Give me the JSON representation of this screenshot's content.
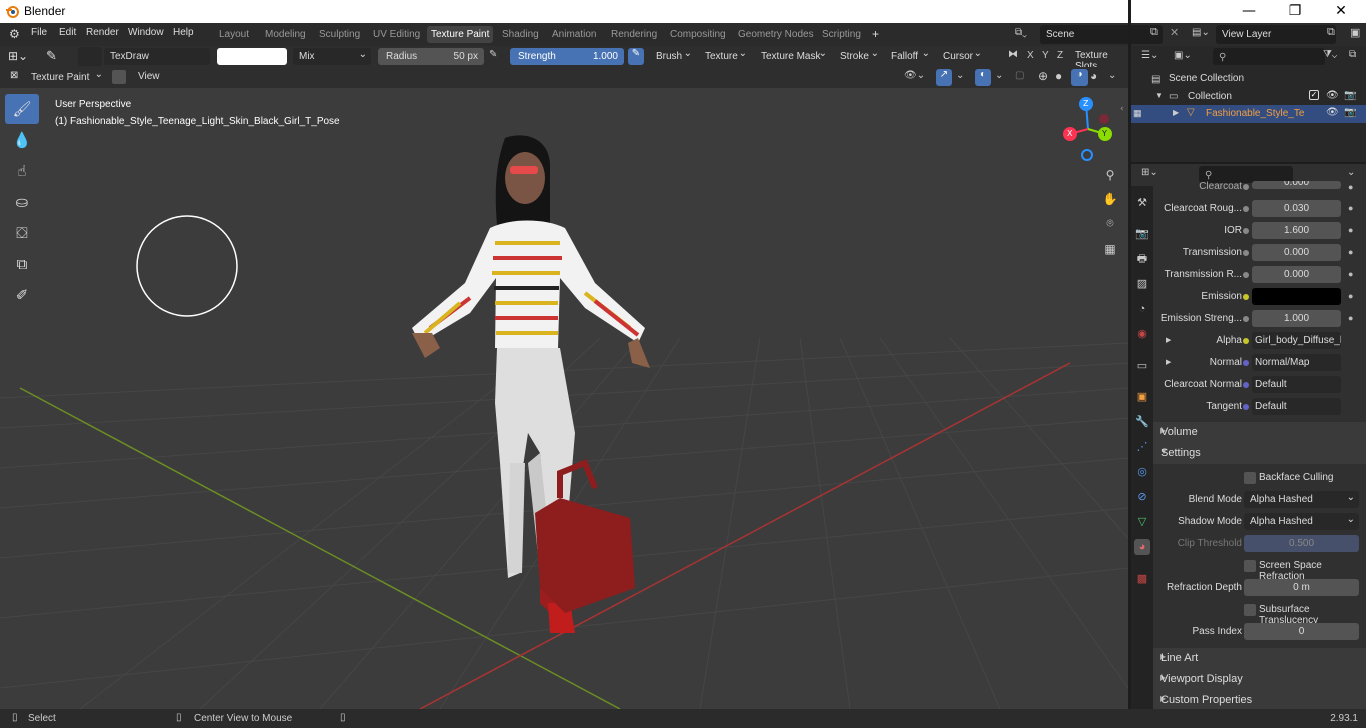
{
  "window": {
    "title": "Blender",
    "minimize": "—",
    "maximize": "❐",
    "close": "✕"
  },
  "menu": {
    "items": [
      "File",
      "Edit",
      "Render",
      "Window",
      "Help"
    ]
  },
  "workspaces": {
    "tabs": [
      "Layout",
      "Modeling",
      "Sculpting",
      "UV Editing",
      "Texture Paint",
      "Shading",
      "Animation",
      "Rendering",
      "Compositing",
      "Geometry Nodes",
      "Scripting"
    ],
    "active": "Texture Paint",
    "add": "+"
  },
  "scene": {
    "name": "Scene",
    "view_layer": "View Layer"
  },
  "tool_header": {
    "brush_name": "TexDraw",
    "blend": "Mix",
    "radius_label": "Radius",
    "radius_value": "50 px",
    "strength_label": "Strength",
    "strength_value": "1.000",
    "strength_fill": 1.0,
    "menus": [
      "Brush",
      "Texture",
      "Texture Mask",
      "Stroke",
      "Falloff",
      "Cursor"
    ],
    "axes": [
      "X",
      "Y",
      "Z"
    ],
    "texture_slots": "Texture Slots"
  },
  "viewport_header": {
    "mode": "Texture Paint",
    "view": "View"
  },
  "viewport": {
    "perspective": "User Perspective",
    "object_label": "(1) Fashionable_Style_Teenage_Light_Skin_Black_Girl_T_Pose",
    "gizmo_axes": {
      "z": "Z",
      "x": "X",
      "y": "Y"
    }
  },
  "outliner": {
    "root": "Scene Collection",
    "collection": "Collection",
    "object": "Fashionable_Style_Teena"
  },
  "properties": {
    "rows": [
      {
        "label": "Clearcoat",
        "value": "0.000"
      },
      {
        "label": "Clearcoat Roug...",
        "value": "0.030"
      },
      {
        "label": "IOR",
        "value": "1.600"
      },
      {
        "label": "Transmission",
        "value": "0.000"
      },
      {
        "label": "Transmission R...",
        "value": "0.000"
      },
      {
        "label": "Emission",
        "value": ""
      },
      {
        "label": "Emission Streng...",
        "value": "1.000"
      }
    ],
    "links": [
      {
        "label": "Alpha",
        "value": "Girl_body_Diffuse_li..."
      },
      {
        "label": "Normal",
        "value": "Normal/Map"
      },
      {
        "label": "Clearcoat Normal",
        "value": "Default"
      },
      {
        "label": "Tangent",
        "value": "Default"
      }
    ],
    "sections": {
      "volume": "Volume",
      "settings": "Settings",
      "line_art": "Line Art",
      "viewport_display": "Viewport Display",
      "custom_properties": "Custom Properties"
    },
    "settings": {
      "backface_culling": "Backface Culling",
      "blend_mode_label": "Blend Mode",
      "blend_mode": "Alpha Hashed",
      "shadow_mode_label": "Shadow Mode",
      "shadow_mode": "Alpha Hashed",
      "clip_threshold_label": "Clip Threshold",
      "clip_threshold": "0.500",
      "screen_space_refraction": "Screen Space Refraction",
      "refraction_depth_label": "Refraction Depth",
      "refraction_depth": "0 m",
      "subsurface_translucency": "Subsurface Translucency",
      "pass_index_label": "Pass Index",
      "pass_index": "0"
    }
  },
  "status": {
    "select": "Select",
    "center_view": "Center View to Mouse",
    "version": "2.93.1"
  },
  "colors": {
    "accent": "#4772b3",
    "header": "#2b2b2b",
    "viewport": "#3c3c3c",
    "x_axis": "#ff3352",
    "y_axis": "#8bdc00",
    "z_axis": "#2890ff"
  }
}
